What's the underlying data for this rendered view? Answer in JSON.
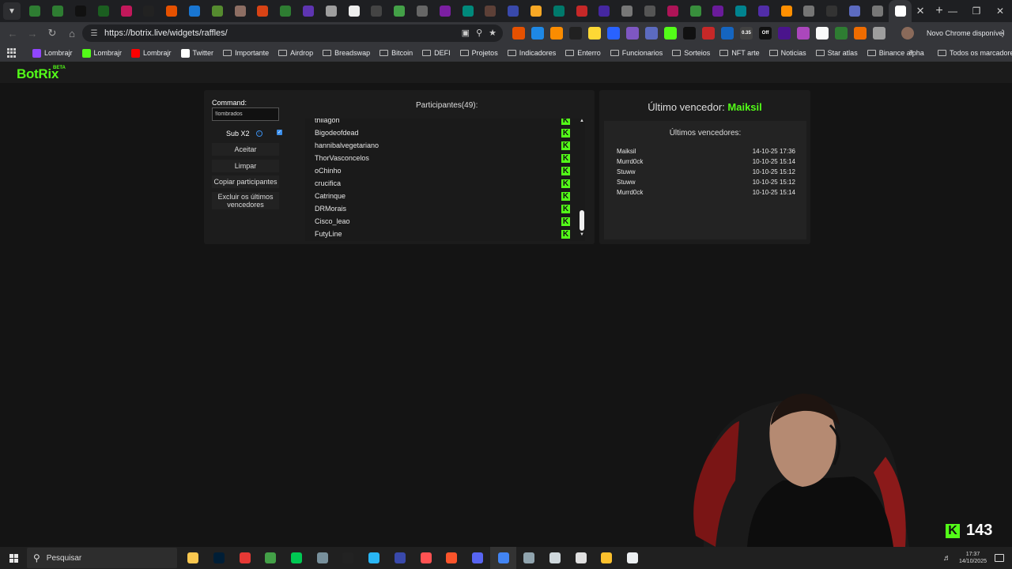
{
  "browser": {
    "tab_colors": [
      "#2e7d32",
      "#2e7d32",
      "#111111",
      "#1b5e20",
      "#c2185b",
      "#222222",
      "#e65100",
      "#1976d2",
      "#558b2f",
      "#8d6e63",
      "#d84315",
      "#2e7d32",
      "#5e35b1",
      "#9e9e9e",
      "#eeeeee",
      "#444444",
      "#43a047",
      "#666666",
      "#7b1fa2",
      "#00897b",
      "#5d4037",
      "#3949ab",
      "#f9a825",
      "#00796b",
      "#c62828",
      "#4527a0",
      "#777777",
      "#555555",
      "#ad1457",
      "#388e3c",
      "#6a1b9a",
      "#00838f",
      "#512da8",
      "#ff8f00",
      "#757575",
      "#333333",
      "#5c6bc0",
      "#777777",
      "#ffffff"
    ],
    "url": "https://botrix.live/widgets/raffles/",
    "update_chip": "Novo Chrome disponível",
    "extension_colors": [
      "#e65100",
      "#1e88e5",
      "#fb8c00",
      "#212121",
      "#fdd835",
      "#2962ff",
      "#7e57c2",
      "#5c6bc0",
      "#53fc18",
      "#111111",
      "#c62828",
      "#1565c0",
      "#424242",
      "#111111",
      "#4a148c",
      "#ab47bc",
      "#fafafa",
      "#2e7d32",
      "#ef6c00",
      "#9e9e9e"
    ],
    "extension_labels": [
      "0.35",
      "Off"
    ],
    "bookmarks": [
      {
        "label": "Lombrajr",
        "color": "#9146ff",
        "icon": "twitch-icon"
      },
      {
        "label": "Lombrajr",
        "color": "#53fc18",
        "icon": "kick-icon"
      },
      {
        "label": "Lombrajr",
        "color": "#ff0000",
        "icon": "youtube-icon"
      },
      {
        "label": "Twitter",
        "color": "#ffffff",
        "icon": "x-icon"
      },
      {
        "label": "Importante",
        "icon": "folder-icon"
      },
      {
        "label": "Airdrop",
        "icon": "folder-icon"
      },
      {
        "label": "Breadswap",
        "icon": "folder-icon"
      },
      {
        "label": "Bitcoin",
        "icon": "folder-icon"
      },
      {
        "label": "DEFI",
        "icon": "folder-icon"
      },
      {
        "label": "Projetos",
        "icon": "folder-icon"
      },
      {
        "label": "Indicadores",
        "icon": "folder-icon"
      },
      {
        "label": "Enterro",
        "icon": "folder-icon"
      },
      {
        "label": "Funcionarios",
        "icon": "folder-icon"
      },
      {
        "label": "Sorteios",
        "icon": "folder-icon"
      },
      {
        "label": "NFT arte",
        "icon": "folder-icon"
      },
      {
        "label": "Noticias",
        "icon": "folder-icon"
      },
      {
        "label": "Star atlas",
        "icon": "folder-icon"
      },
      {
        "label": "Binance alpha",
        "icon": "folder-icon"
      }
    ],
    "all_bookmarks": "Todos os marcadores"
  },
  "app": {
    "logo": "BotRix",
    "logo_badge": "BETA",
    "command_label": "Command:",
    "command_value": "!lombrados",
    "sub_label": "Sub X2",
    "sub_checked": true,
    "buttons": {
      "accept": "Aceitar",
      "clear": "Limpar",
      "copy": "Copiar participantes",
      "exclude": [
        "Excluir os últimos",
        "vencedores"
      ]
    },
    "participants_title": "Participantes(49):",
    "participants": [
      "thiiagoh",
      "Bigodeofdead",
      "hannibalvegetariano",
      "ThorVasconcelos",
      "oChinho",
      "crucifica",
      "Catrinque",
      "DRMorais",
      "Cisco_leao",
      "FutyLine"
    ],
    "last_winner_label": "Último vencedor:",
    "last_winner_name": "Maiksil",
    "winners_heading": "Últimos vencedores:",
    "winners": [
      {
        "name": "Maiksil",
        "date": "14-10-25 17:36"
      },
      {
        "name": "Murrd0ck",
        "date": "10-10-25 15:14"
      },
      {
        "name": "Stuww",
        "date": "10-10-25 15:12"
      },
      {
        "name": "Stuww",
        "date": "10-10-25 15:12"
      },
      {
        "name": "Murrd0ck",
        "date": "10-10-25 15:14"
      }
    ],
    "kick_count": "143"
  },
  "taskbar": {
    "search_placeholder": "Pesquisar",
    "app_colors": [
      "#f9c74f",
      "#001e36",
      "#e53935",
      "#43a047",
      "#00c853",
      "#78909c",
      "#222222",
      "#29b6f6",
      "#3949ab",
      "#ff5252",
      "#fb542b",
      "#5865f2",
      "#4285f4",
      "#90a4ae",
      "#cfd8dc",
      "#e0e0e0",
      "#fbc02d",
      "#eceff1"
    ],
    "time": "17:37",
    "date": "14/10/2025"
  }
}
